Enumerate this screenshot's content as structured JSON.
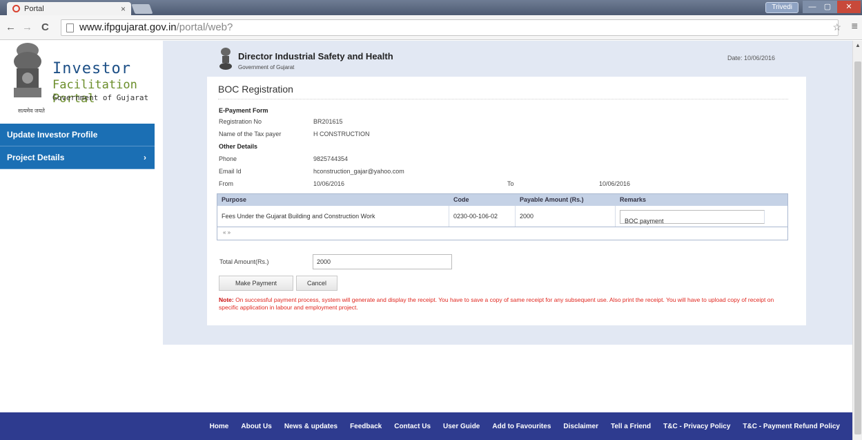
{
  "browser": {
    "tab_title": "Portal",
    "tab_close": "×",
    "user_badge": "Trivedi",
    "minimize": "—",
    "maximize": "▢",
    "close": "✕",
    "url_host": "www.ifpgujarat.gov.in",
    "url_path": "/portal/web?",
    "back": "←",
    "forward": "→",
    "reload": "C",
    "star": "☆",
    "menu": "≡"
  },
  "sidebar": {
    "logo_investor": "Investor",
    "logo_facilitation": "Facilitation Portal",
    "logo_gov": "Government of Gujarat",
    "logo_motto": "सत्यमेव जयते",
    "items": [
      {
        "label": "Update Investor Profile",
        "chevron": ""
      },
      {
        "label": "Project Details",
        "chevron": "›"
      }
    ]
  },
  "header": {
    "title": "Director Industrial Safety and Health",
    "subtitle": "Government of Gujarat",
    "date": "Date: 10/06/2016"
  },
  "form": {
    "section_title": "BOC Registration",
    "epayment_label": "E-Payment Form",
    "registration_label": "Registration No",
    "registration_value": "BR201615",
    "taxpayer_label": "Name of the Tax payer",
    "taxpayer_value": "H CONSTRUCTION",
    "other_details_label": "Other Details",
    "phone_label": "Phone",
    "phone_value": "9825744354",
    "email_label": "Email Id",
    "email_value": "hconstruction_gajar@yahoo.com",
    "from_label": "From",
    "from_value": "10/06/2016",
    "to_label": "To",
    "to_value": "10/06/2016",
    "grid": {
      "headers": [
        "Purpose",
        "Code",
        "Payable Amount (Rs.)",
        "Remarks"
      ],
      "rows": [
        {
          "purpose": "Fees Under the Gujarat Building and Construction Work",
          "code": "0230-00-106-02",
          "amount": "2000",
          "remarks": "BOC payment"
        }
      ],
      "pager": "« »"
    },
    "total_label": "Total Amount(Rs.)",
    "total_value": "2000",
    "make_payment": "Make Payment",
    "cancel": "Cancel",
    "note_label": "Note:",
    "note_text": " On successful payment process, system will generate and display the receipt. You have to save a copy of same receipt for any subsequent use. Also print the receipt. You will have to upload copy of receipt on specific application in labour and employment project."
  },
  "footer": {
    "links": [
      "Home",
      "About Us",
      "News & updates",
      "Feedback",
      "Contact Us",
      "User Guide",
      "Add to Favourites",
      "Disclaimer",
      "Tell a Friend",
      "T&C - Privacy Policy",
      "T&C - Payment Refund Policy"
    ]
  }
}
